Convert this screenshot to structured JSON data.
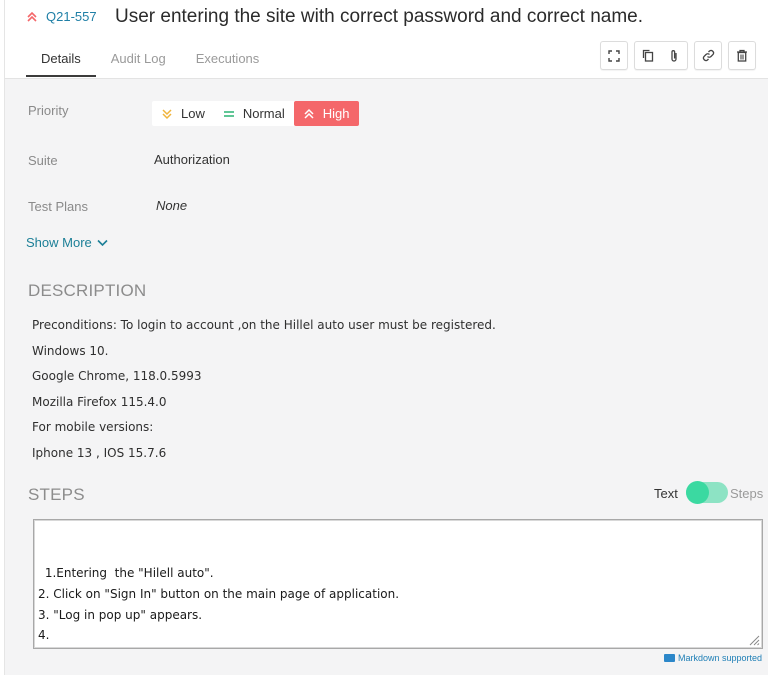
{
  "issue": {
    "key": "Q21-557",
    "title": "User entering the site with correct password and correct name.",
    "priority_icon": "double-chevron-up-icon"
  },
  "tabs": [
    {
      "label": "Details",
      "active": true
    },
    {
      "label": "Audit Log",
      "active": false
    },
    {
      "label": "Executions",
      "active": false
    }
  ],
  "toolbar": {
    "icons": [
      "expand-icon",
      "copy-icon",
      "attach-icon",
      "link-icon",
      "delete-icon"
    ]
  },
  "fields": {
    "priority_label": "Priority",
    "priority_options": [
      {
        "label": "Low",
        "icon": "chevron-down-double-icon",
        "color": "#f0b43c"
      },
      {
        "label": "Normal",
        "icon": "equals-icon",
        "color": "#38b87c"
      },
      {
        "label": "High",
        "icon": "chevron-up-double-icon",
        "color": "#ffffff",
        "selected": true
      }
    ],
    "selected_color": "#f4676a",
    "suite_label": "Suite",
    "suite_value": "Authorization",
    "test_plans_label": "Test Plans",
    "test_plans_value": "None"
  },
  "show_more": "Show More",
  "description": {
    "heading": "DESCRIPTION",
    "lines": [
      "Preconditions: To login to account ,on the Hillel auto user must be registered.",
      "Windows 10.",
      "Google Chrome, 118.0.5993",
      "Mozilla Firefox 115.4.0",
      "For mobile versions:",
      "Iphone 13 , IOS 15.7.6"
    ]
  },
  "steps": {
    "heading": "STEPS",
    "toggle_text": "Text",
    "toggle_steps": "Steps",
    "toggle_color": "#3bd9a1",
    "lines": [
      " 1.Entering  the \"Hilell auto\".",
      "2. Click on \"Sign In\" button on the main page of application.",
      "3. \"Log in pop up\" appears.",
      "4."
    ],
    "markdown_note": "Markdown supported"
  }
}
